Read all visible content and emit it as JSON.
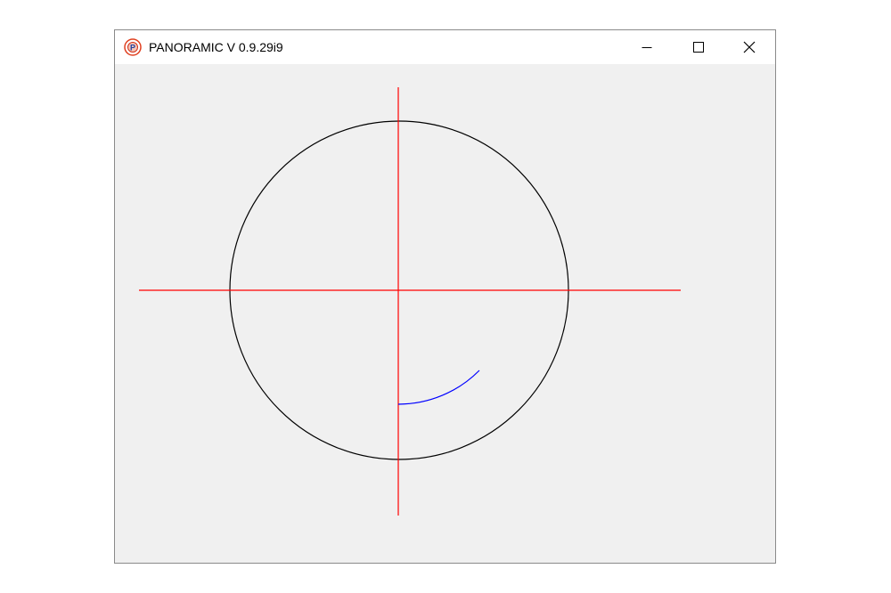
{
  "window": {
    "title": "PANORAMIC V 0.9.29i9",
    "icon": "panoramic-app-icon",
    "controls": {
      "minimize_icon": "minimize-icon",
      "maximize_icon": "maximize-icon",
      "close_icon": "close-icon"
    }
  },
  "canvas": {
    "background": "#f0f0f0",
    "circle_color": "#000000",
    "axis_color": "#ff0000",
    "arc_color": "#0000ff"
  }
}
